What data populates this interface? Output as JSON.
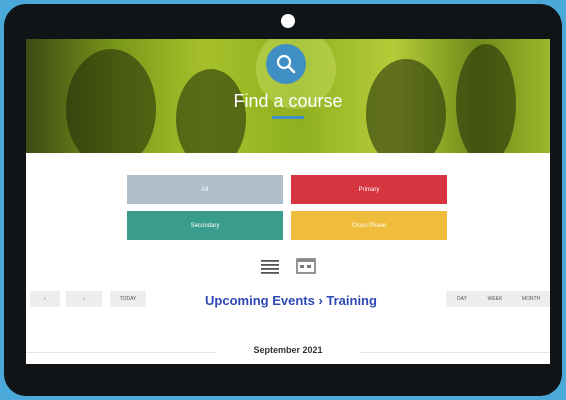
{
  "hero": {
    "title": "Find a course",
    "icon": "search-icon"
  },
  "categories": [
    {
      "label": "All",
      "color": "#b0bfcc"
    },
    {
      "label": "Primary",
      "color": "#d6353f"
    },
    {
      "label": "Secondary",
      "color": "#3a9c8c"
    },
    {
      "label": "Cross Phase",
      "color": "#f0bc3c"
    }
  ],
  "view_toggles": [
    {
      "name": "list-view-icon"
    },
    {
      "name": "calendar-view-icon"
    }
  ],
  "calendar": {
    "prev_label": "‹",
    "next_label": "›",
    "today_label": "TODAY",
    "title": "Upcoming Events › Training",
    "views": [
      "DAY",
      "WEEK",
      "MONTH"
    ],
    "month": "September 2021"
  },
  "colors": {
    "accent_blue": "#3f8fc4",
    "title_blue": "#2e49b4",
    "background": "#4aa9d8",
    "device": "#111417"
  }
}
